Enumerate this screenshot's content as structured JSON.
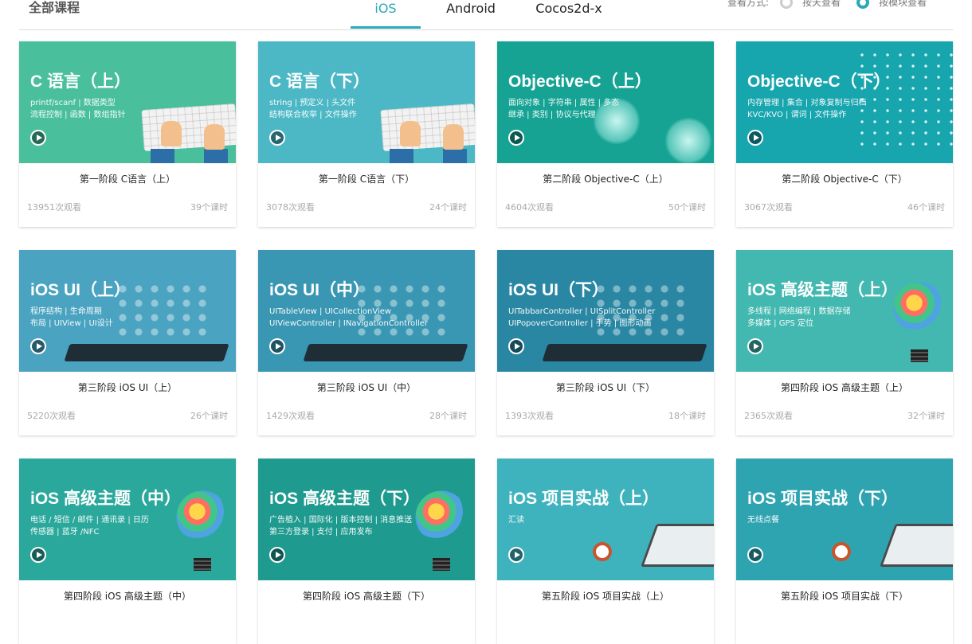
{
  "header": {
    "title": "全部课程",
    "tabs": [
      {
        "label": "iOS",
        "active": true
      },
      {
        "label": "Android",
        "active": false
      },
      {
        "label": "Cocos2d-x",
        "active": false
      }
    ],
    "view_mode": {
      "label": "查看方式:",
      "options": [
        {
          "label": "按天查看",
          "selected": false
        },
        {
          "label": "按模块查看",
          "selected": true
        }
      ]
    }
  },
  "courses": [
    {
      "thumb_title": "C 语言（上）",
      "thumb_sub": "printf/scanf  |  数据类型\n流程控制  |  函数  |  数组指针",
      "name": "第一阶段 C语言（上）",
      "views": "13951次观看",
      "lessons": "39个课时",
      "color": "#49bf9b",
      "deco": "keyboard"
    },
    {
      "thumb_title": "C 语言（下）",
      "thumb_sub": "string  |  预定义  |  头文件\n结构联合枚举  |  文件操作",
      "name": "第一阶段 C语言（下）",
      "views": "3078次观看",
      "lessons": "24个课时",
      "color": "#4cb8c5",
      "deco": "keyboard"
    },
    {
      "thumb_title": "Objective-C（上）",
      "thumb_sub": "面向对象  |  字符串  |  属性  |  多态\n继承  |  类别  |  协议与代理",
      "name": "第二阶段 Objective-C（上）",
      "views": "4604次观看",
      "lessons": "50个课时",
      "color": "#16a394",
      "deco": "hands"
    },
    {
      "thumb_title": "Objective-C（下）",
      "thumb_sub": "内存管理  |  集合  |  对象复制与归档\nKVC/KVO  |  谓词  |  文件操作",
      "name": "第二阶段 Objective-C（下）",
      "views": "3067次观看",
      "lessons": "46个课时",
      "color": "#17a5ae",
      "deco": "dots"
    },
    {
      "thumb_title": "iOS UI（上）",
      "thumb_sub": "程序结构  |  生命周期\n布局  |  UIView  |  UI设计",
      "name": "第三阶段 iOS UI（上）",
      "views": "5220次观看",
      "lessons": "26个课时",
      "color": "#4aa3c0",
      "deco": "tablet"
    },
    {
      "thumb_title": "iOS UI（中）",
      "thumb_sub": "UITableView  |  UICollectionView\nUIViewController  |  INavigationController",
      "name": "第三阶段 iOS UI（中）",
      "views": "1429次观看",
      "lessons": "28个课时",
      "color": "#3a97b3",
      "deco": "tablet"
    },
    {
      "thumb_title": "iOS UI（下）",
      "thumb_sub": "UITabbarController  |  UISplitController\nUIPopoverController  |  手势  |  图形动画",
      "name": "第三阶段 iOS UI（下）",
      "views": "1393次观看",
      "lessons": "18个课时",
      "color": "#2a87a3",
      "deco": "tablet"
    },
    {
      "thumb_title": "iOS 高级主题（上）",
      "thumb_sub": "多线程  |  网络编程  |  数据存储\n多媒体  |  GPS 定位",
      "name": "第四阶段 iOS 高级主题（上）",
      "views": "2365次观看",
      "lessons": "32个课时",
      "color": "#43b8b0",
      "deco": "bulb"
    },
    {
      "thumb_title": "iOS 高级主题（中）",
      "thumb_sub": "电话 / 短信 / 邮件  |  通讯录  |  日历\n传感器  |  蓝牙 /NFC",
      "name": "第四阶段 iOS 高级主题（中）",
      "views": "",
      "lessons": "",
      "color": "#2ba89c",
      "deco": "bulb"
    },
    {
      "thumb_title": "iOS 高级主题（下）",
      "thumb_sub": "广告植入  |  国际化  |  版本控制  |  消息推送\n第三方登录  |  支付  |  应用发布",
      "name": "第四阶段 iOS 高级主题（下）",
      "views": "",
      "lessons": "",
      "color": "#1e9a8f",
      "deco": "bulb"
    },
    {
      "thumb_title": "iOS 项目实战（上）",
      "thumb_sub": "汇读",
      "name": "第五阶段 iOS 项目实战（上）",
      "views": "",
      "lessons": "",
      "color": "#3fb3bd",
      "deco": "desk"
    },
    {
      "thumb_title": "iOS 项目实战（下）",
      "thumb_sub": "无线点餐",
      "name": "第五阶段 iOS 项目实战（下）",
      "views": "",
      "lessons": "",
      "color": "#2ea4b1",
      "deco": "desk"
    }
  ]
}
